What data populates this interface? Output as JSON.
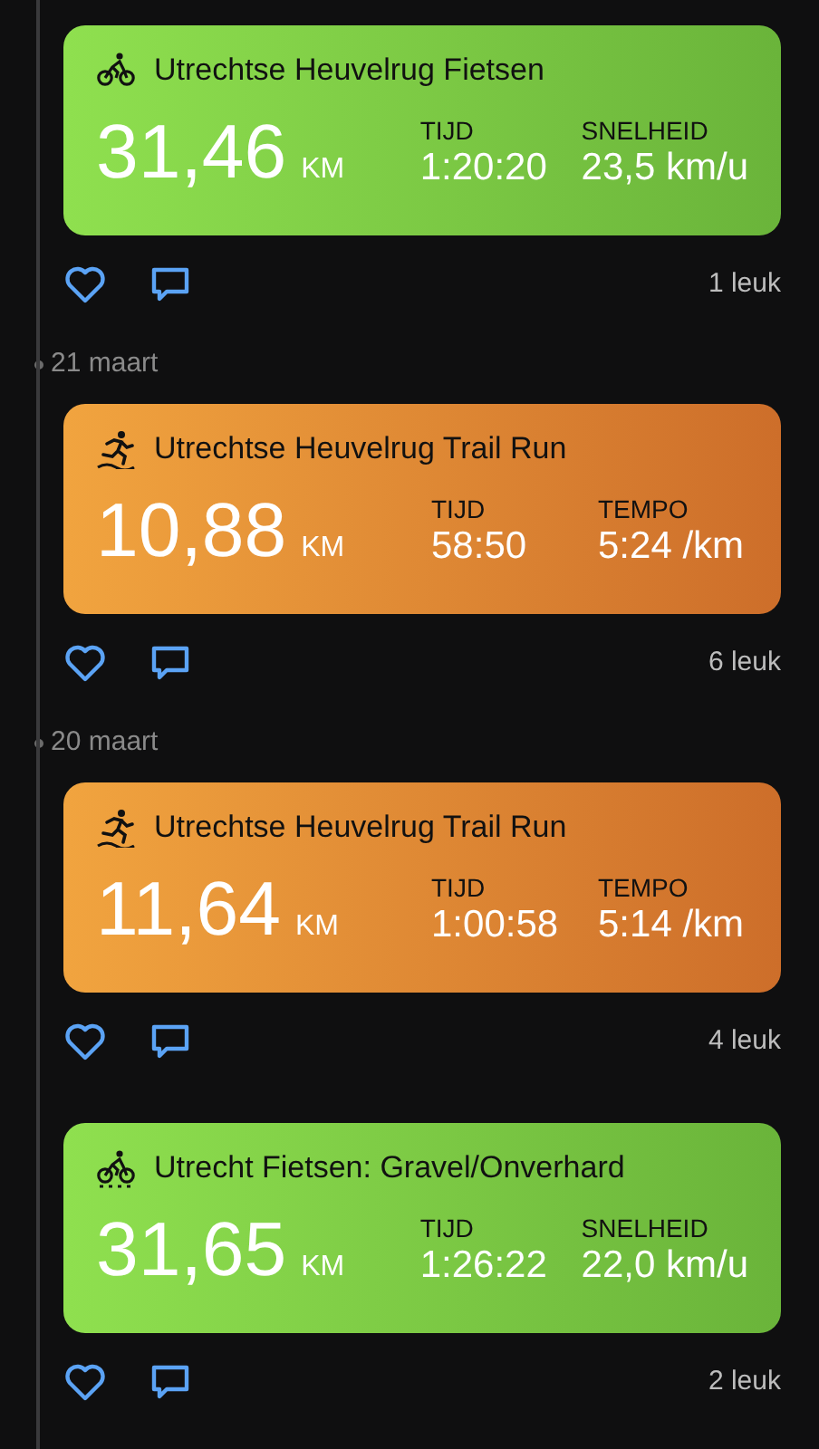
{
  "feed": [
    {
      "kind": "cycling",
      "title": "Utrechtse Heuvelrug Fietsen",
      "distance": "31,46",
      "unit": "KM",
      "stats": [
        {
          "label": "TIJD",
          "value": "1:20:20"
        },
        {
          "label": "SNELHEID",
          "value": "23,5 km/u"
        }
      ],
      "likes": "1 leuk"
    },
    {
      "kind": "date",
      "label": "21 maart"
    },
    {
      "kind": "trail_run",
      "title": "Utrechtse Heuvelrug Trail Run",
      "distance": "10,88",
      "unit": "KM",
      "stats": [
        {
          "label": "TIJD",
          "value": "58:50"
        },
        {
          "label": "TEMPO",
          "value": "5:24 /km"
        }
      ],
      "likes": "6 leuk"
    },
    {
      "kind": "date",
      "label": "20 maart"
    },
    {
      "kind": "trail_run",
      "title": "Utrechtse Heuvelrug Trail Run",
      "distance": "11,64",
      "unit": "KM",
      "stats": [
        {
          "label": "TIJD",
          "value": "1:00:58"
        },
        {
          "label": "TEMPO",
          "value": "5:14 /km"
        }
      ],
      "likes": "4 leuk"
    },
    {
      "kind": "gravel",
      "title": "Utrecht Fietsen: Gravel/Onverhard",
      "distance": "31,65",
      "unit": "KM",
      "stats": [
        {
          "label": "TIJD",
          "value": "1:26:22"
        },
        {
          "label": "SNELHEID",
          "value": "22,0 km/u"
        }
      ],
      "likes": "2 leuk"
    }
  ]
}
